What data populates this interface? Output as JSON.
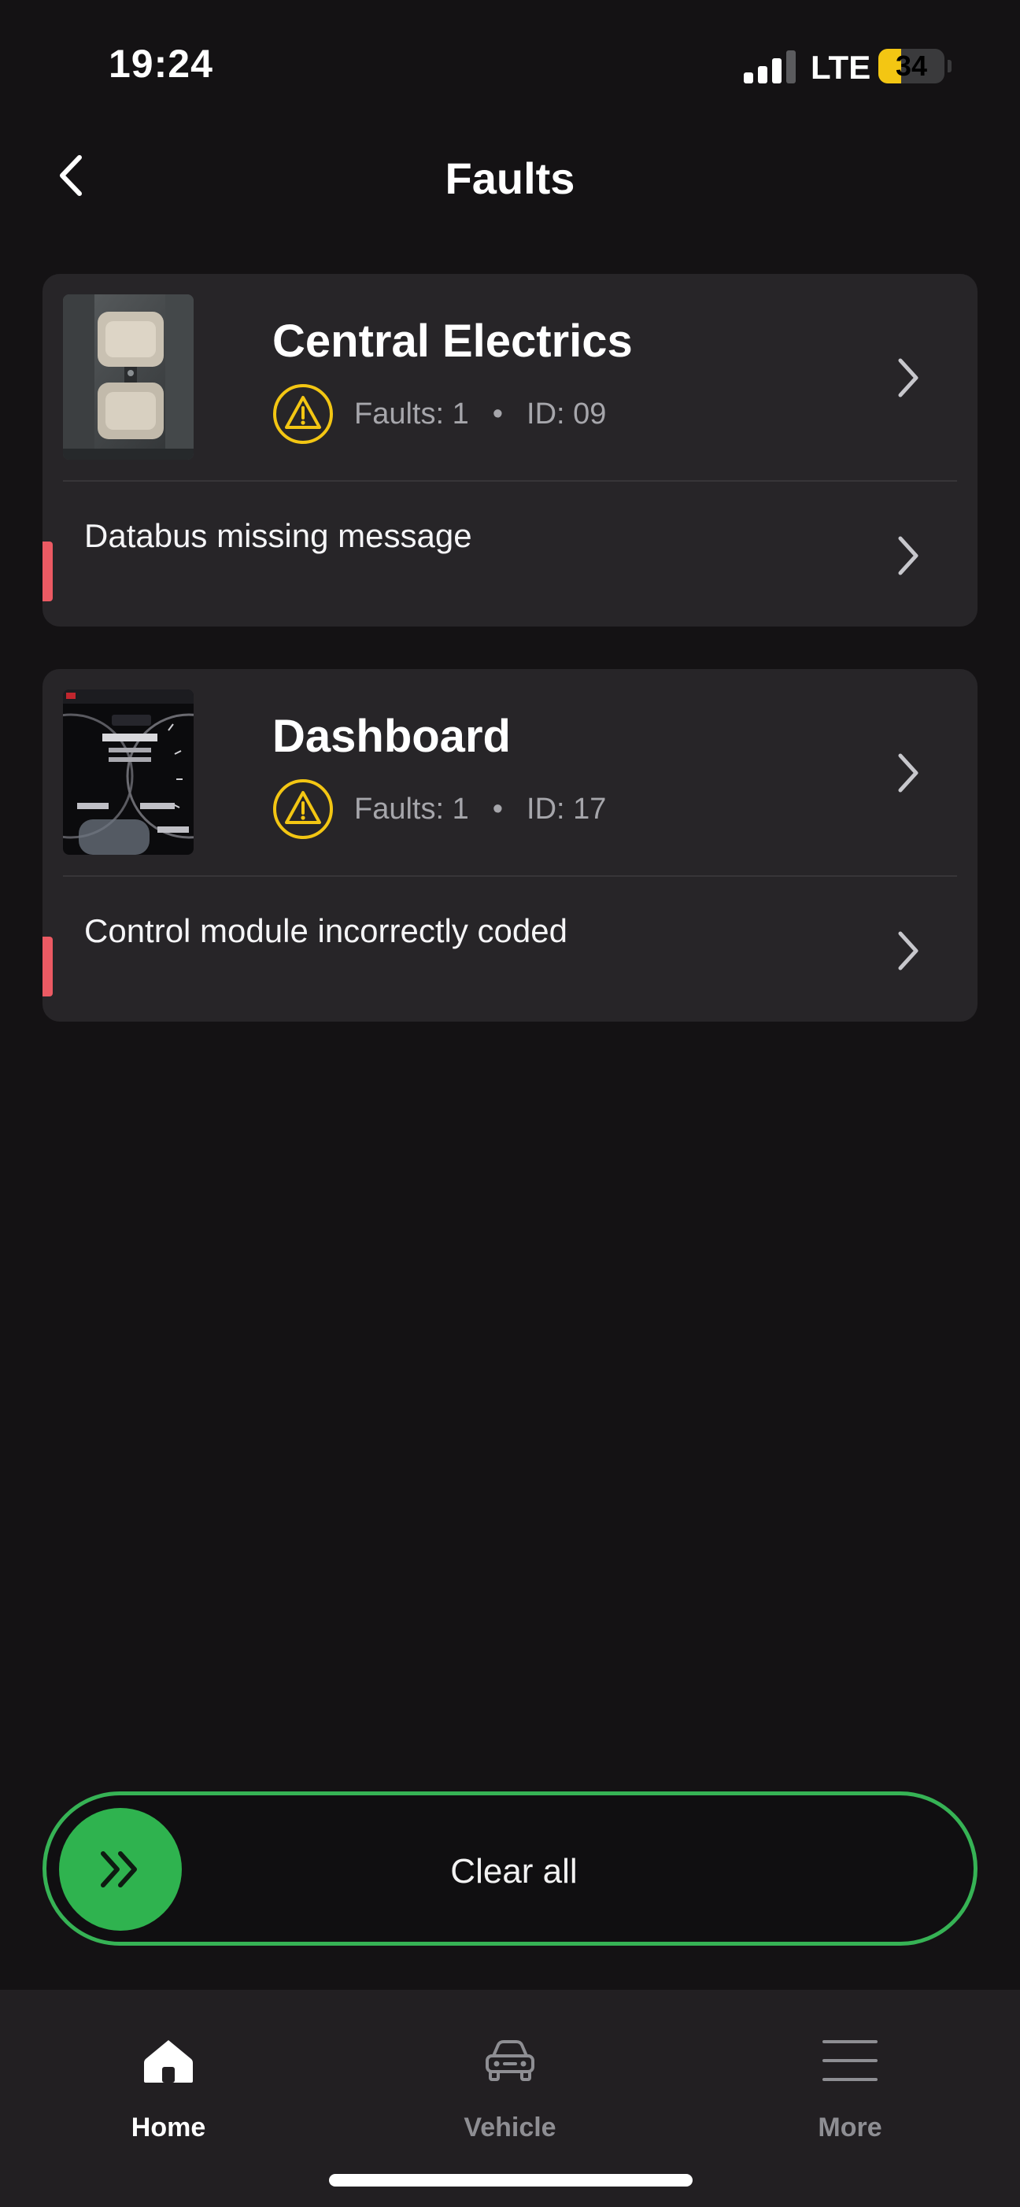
{
  "status_bar": {
    "time": "19:24",
    "network": "LTE",
    "battery_level": "34",
    "battery_fraction": 0.34
  },
  "header": {
    "title": "Faults",
    "back_icon": "chevron-left-icon"
  },
  "modules": [
    {
      "name": "Central Electrics",
      "faults_label": "Faults: 1",
      "id_label": "ID: 09",
      "thumbnail": "car-interior-image",
      "fault_message": "Databus missing message"
    },
    {
      "name": "Dashboard",
      "faults_label": "Faults: 1",
      "id_label": "ID: 17",
      "thumbnail": "instrument-cluster-image",
      "fault_message": "Control module incorrectly coded"
    }
  ],
  "clear_all": {
    "label": "Clear all",
    "icon": "double-chevron-right-icon"
  },
  "bottom_nav": {
    "items": [
      {
        "label": "Home",
        "icon": "home-icon",
        "active": true
      },
      {
        "label": "Vehicle",
        "icon": "car-icon",
        "active": false
      },
      {
        "label": "More",
        "icon": "menu-icon",
        "active": false
      }
    ]
  },
  "colors": {
    "background": "#141214",
    "card": "#272528",
    "accent_green": "#2fb34f",
    "warning_yellow": "#f3c613",
    "fault_red": "#ec5a63",
    "muted_text": "#a6a6ab"
  }
}
